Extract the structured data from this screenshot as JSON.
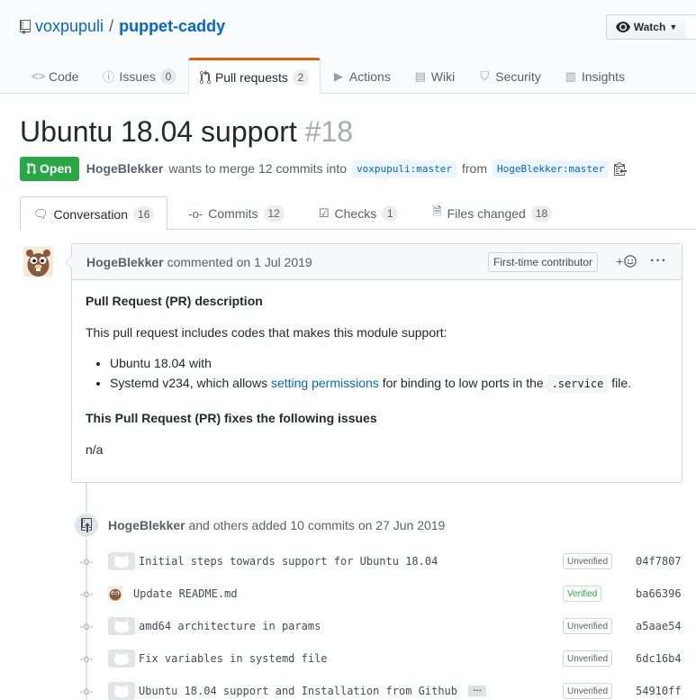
{
  "repo": {
    "owner": "voxpupuli",
    "separator": "/",
    "name": "puppet-caddy"
  },
  "watch": {
    "label": "Watch"
  },
  "nav": [
    {
      "label": "Code",
      "icon": "code-icon"
    },
    {
      "label": "Issues",
      "count": "0",
      "icon": "issue-icon"
    },
    {
      "label": "Pull requests",
      "count": "2",
      "icon": "pull-request-icon"
    },
    {
      "label": "Actions",
      "icon": "play-icon"
    },
    {
      "label": "Wiki",
      "icon": "book-icon"
    },
    {
      "label": "Security",
      "icon": "shield-icon"
    },
    {
      "label": "Insights",
      "icon": "graph-icon"
    }
  ],
  "pr": {
    "title": "Ubuntu 18.04 support",
    "number": "#18",
    "state": "Open",
    "author": "HogeBlekker",
    "merge_text": "wants to merge 12 commits into",
    "base_branch": "voxpupuli:master",
    "from_text": "from",
    "head_branch": "HogeBlekker:master"
  },
  "tabs": [
    {
      "label": "Conversation",
      "count": "16"
    },
    {
      "label": "Commits",
      "count": "12"
    },
    {
      "label": "Checks",
      "count": "1"
    },
    {
      "label": "Files changed",
      "count": "18"
    }
  ],
  "comment": {
    "author": "HogeBlekker",
    "meta": "commented on 1 Jul 2019",
    "badge": "First-time contributor",
    "heading1": "Pull Request (PR) description",
    "intro": "This pull request includes codes that makes this module support:",
    "bullet1": "Ubuntu 18.04 with",
    "bullet2_pre": "Systemd v234, which allows",
    "bullet2_link": "setting permissions",
    "bullet2_mid": "for binding to low ports in the",
    "bullet2_code": ".service",
    "bullet2_post": "file.",
    "heading2": "This Pull Request (PR) fixes the following issues",
    "footer": "n/a"
  },
  "event": {
    "author": "HogeBlekker",
    "text": "and others added 10 commits on 27 Jun 2019"
  },
  "commits": [
    {
      "message": "Initial steps towards support for Ubuntu 18.04",
      "status": "Unverified",
      "sha": "04f7807"
    },
    {
      "message": "Update README.md",
      "status": "Verified",
      "sha": "ba66396"
    },
    {
      "message": "amd64 architecture in params",
      "status": "Unverified",
      "sha": "a5aae54"
    },
    {
      "message": "Fix variables in systemd file",
      "status": "Unverified",
      "sha": "6dc16b4"
    },
    {
      "message": "Ubuntu 18.04 support and Installation from Github",
      "status": "Unverified",
      "sha": "54910ff",
      "ellipsis": "…"
    }
  ],
  "colors": {
    "link": "#0366d6",
    "open": "#28a745",
    "accent_tab": "#e36209"
  }
}
